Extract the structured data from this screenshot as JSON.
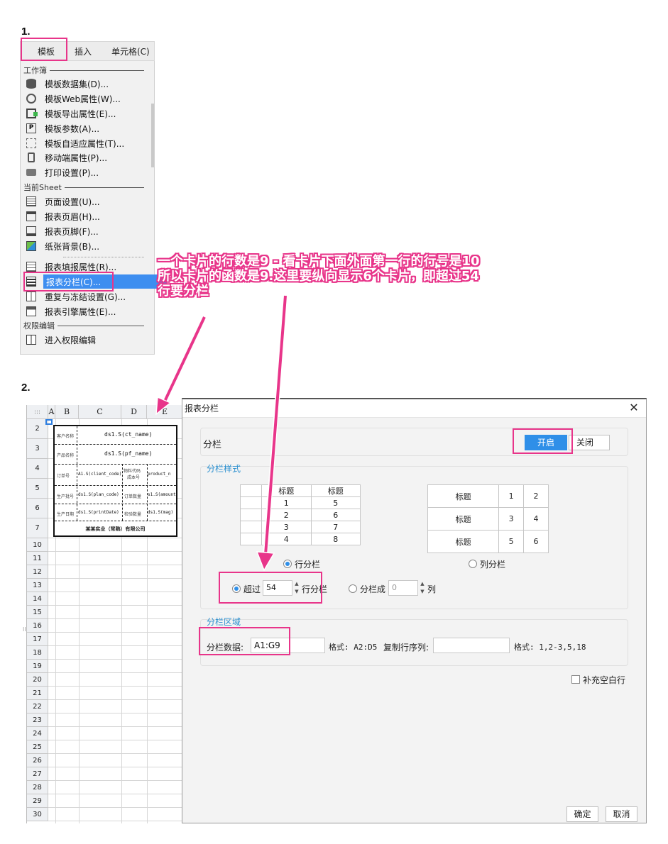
{
  "steps": {
    "one": "1.",
    "two": "2."
  },
  "menubar": {
    "items": [
      "模板",
      "插入",
      "单元格(C)"
    ]
  },
  "dropdown": {
    "section_workbook": "工作簿",
    "section_sheet": "当前Sheet",
    "section_perm": "权限编辑",
    "items": [
      {
        "label": "模板数据集(D)...",
        "icon": "database-icon"
      },
      {
        "label": "模板Web属性(W)...",
        "icon": "globe-icon"
      },
      {
        "label": "模板导出属性(E)...",
        "icon": "export-icon"
      },
      {
        "label": "模板参数(A)...",
        "icon": "parameter-icon"
      },
      {
        "label": "模板自适应属性(T)...",
        "icon": "adaptive-icon"
      },
      {
        "label": "移动端属性(P)...",
        "icon": "mobile-icon"
      },
      {
        "label": "打印设置(P)...",
        "icon": "printer-icon"
      },
      {
        "label": "页面设置(U)...",
        "icon": "page-setup-icon"
      },
      {
        "label": "报表页眉(H)...",
        "icon": "header-icon"
      },
      {
        "label": "报表页脚(F)...",
        "icon": "footer-icon"
      },
      {
        "label": "纸张背景(B)...",
        "icon": "background-icon"
      },
      {
        "label": "报表填报属性(R)...",
        "icon": "fill-icon"
      },
      {
        "label": "报表分栏(C)...",
        "icon": "columns-icon"
      },
      {
        "label": "重复与冻结设置(G)...",
        "icon": "freeze-icon"
      },
      {
        "label": "报表引擎属性(E)...",
        "icon": "engine-icon"
      },
      {
        "label": "进入权限编辑",
        "icon": "permission-icon"
      }
    ]
  },
  "annotation": {
    "line1": "一个卡片的行数是9 - 看卡片下面外面第一行的行号是10",
    "line2": "所以卡片的函数是9.这里要纵向显示6个卡片，即超过54",
    "line3": "行要分栏"
  },
  "sheet": {
    "col_headers": [
      "A",
      "B",
      "C",
      "D",
      "E"
    ],
    "row_numbers": [
      "2",
      "3",
      "4",
      "5",
      "6",
      "7",
      "10",
      "11",
      "12",
      "13",
      "14",
      "15",
      "16",
      "17",
      "18",
      "19",
      "20",
      "21",
      "22",
      "23",
      "24",
      "25",
      "26",
      "27",
      "28",
      "29",
      "30"
    ],
    "card": {
      "labels": [
        "客户名称",
        "产品名称",
        "订单号",
        "物料代码",
        "成本号",
        "生产批号",
        "订单数量",
        "生产日期",
        "检验数量"
      ],
      "values": [
        "ds1.S(ct_name)",
        "ds1.S(pf_name)",
        "A1.S(client_code)",
        "product_n",
        "ds1.S(plan_code)",
        "s1.S(amount",
        "ds1.S(printDate)",
        "ds1.S(mag)"
      ],
      "footer": "某某实业（常熟）有限公司"
    }
  },
  "dialog": {
    "title": "报表分栏",
    "section_fenlan": "分栏",
    "btn_on": "开启",
    "btn_off": "关闭",
    "style_title": "分栏样式",
    "row_preview": {
      "headers": [
        "标题",
        "标题"
      ],
      "rows": [
        [
          "1",
          "5"
        ],
        [
          "2",
          "6"
        ],
        [
          "3",
          "7"
        ],
        [
          "4",
          "8"
        ]
      ]
    },
    "col_preview": {
      "rows": [
        [
          "标题",
          "1",
          "2"
        ],
        [
          "标题",
          "3",
          "4"
        ],
        [
          "标题",
          "5",
          "6"
        ]
      ]
    },
    "radio_row": "行分栏",
    "radio_col": "列分栏",
    "exceed_label": "超过",
    "exceed_value": "54",
    "exceed_suffix": "行分栏",
    "split_into_label": "分栏成",
    "split_into_value": "0",
    "split_into_suffix": "列",
    "area_title": "分栏区域",
    "area_data_label": "分栏数据:",
    "area_data_value": "A1:G9",
    "format1": "格式: A2:D5",
    "repeat_label": "复制行序列:",
    "repeat_value": "",
    "format2": "格式: 1,2-3,5,18",
    "fill_blank": "补充空白行",
    "ok": "确定",
    "cancel": "取消"
  },
  "colors": {
    "highlight": "#e8358a",
    "accent": "#2f8fe8",
    "section_title": "#2a8fcf"
  }
}
